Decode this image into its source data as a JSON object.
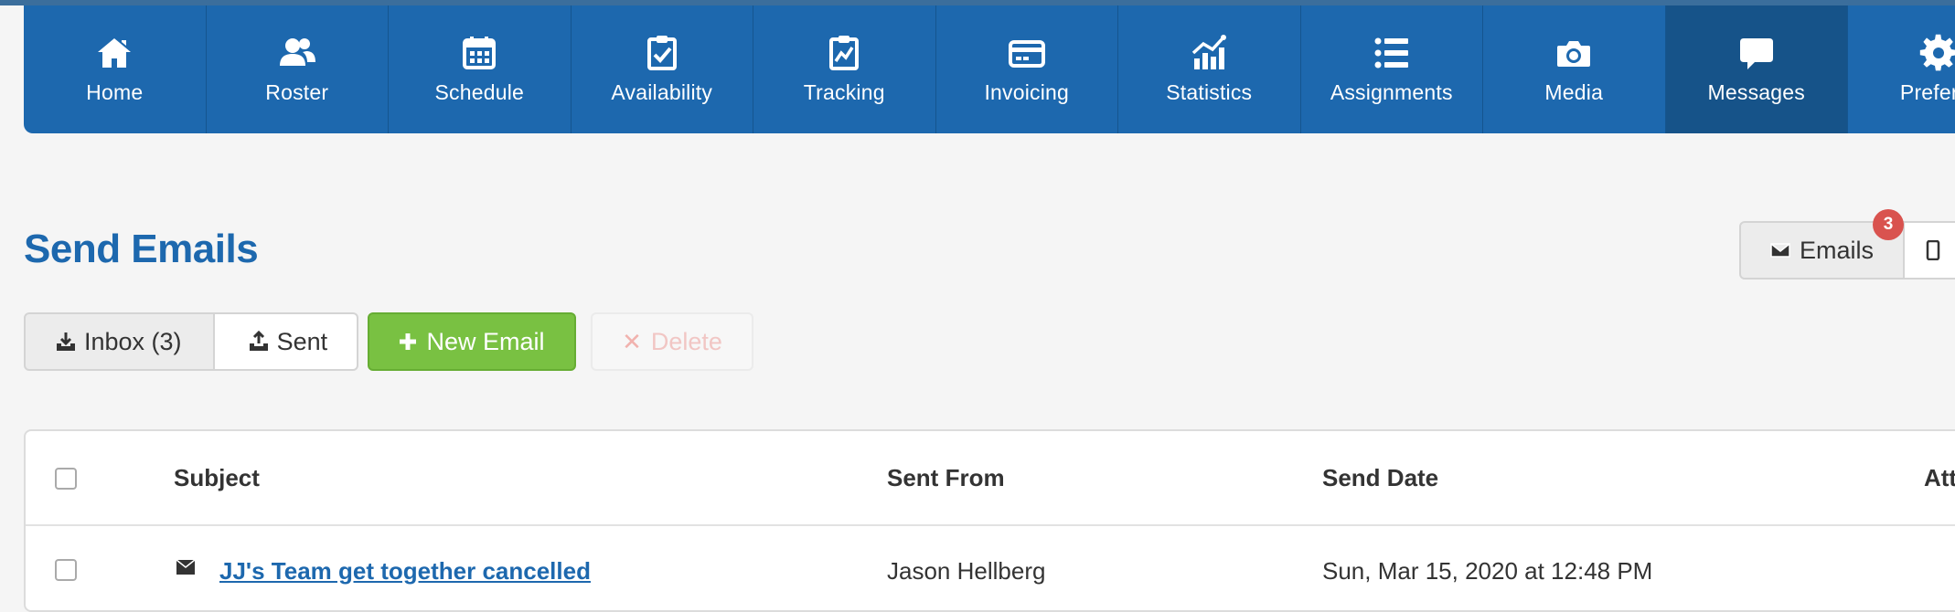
{
  "nav": {
    "items": [
      {
        "label": "Home",
        "icon": "home-icon"
      },
      {
        "label": "Roster",
        "icon": "users-icon"
      },
      {
        "label": "Schedule",
        "icon": "calendar-icon"
      },
      {
        "label": "Availability",
        "icon": "clipboard-check-icon"
      },
      {
        "label": "Tracking",
        "icon": "clipboard-chart-icon"
      },
      {
        "label": "Invoicing",
        "icon": "credit-card-icon"
      },
      {
        "label": "Statistics",
        "icon": "chart-icon"
      },
      {
        "label": "Assignments",
        "icon": "list-icon"
      },
      {
        "label": "Media",
        "icon": "camera-icon"
      },
      {
        "label": "Messages",
        "icon": "chat-bubble-icon",
        "active": true
      },
      {
        "label": "Preferer",
        "icon": "gear-icon"
      }
    ],
    "accent_color": "#1d68ae",
    "active_color": "#165389"
  },
  "page": {
    "title": "Send Emails"
  },
  "view_toggle": {
    "emails_label": "Emails",
    "badge_count": "3"
  },
  "toolbar": {
    "inbox_label": "Inbox (3)",
    "sent_label": "Sent",
    "new_email_label": "New Email",
    "delete_label": "Delete"
  },
  "table": {
    "columns": [
      "Subject",
      "Sent From",
      "Send Date",
      "Att"
    ],
    "rows": [
      {
        "subject": "JJ's Team get together cancelled",
        "sent_from": "Jason Hellberg",
        "send_date": "Sun, Mar 15, 2020 at 12:48 PM"
      }
    ]
  }
}
